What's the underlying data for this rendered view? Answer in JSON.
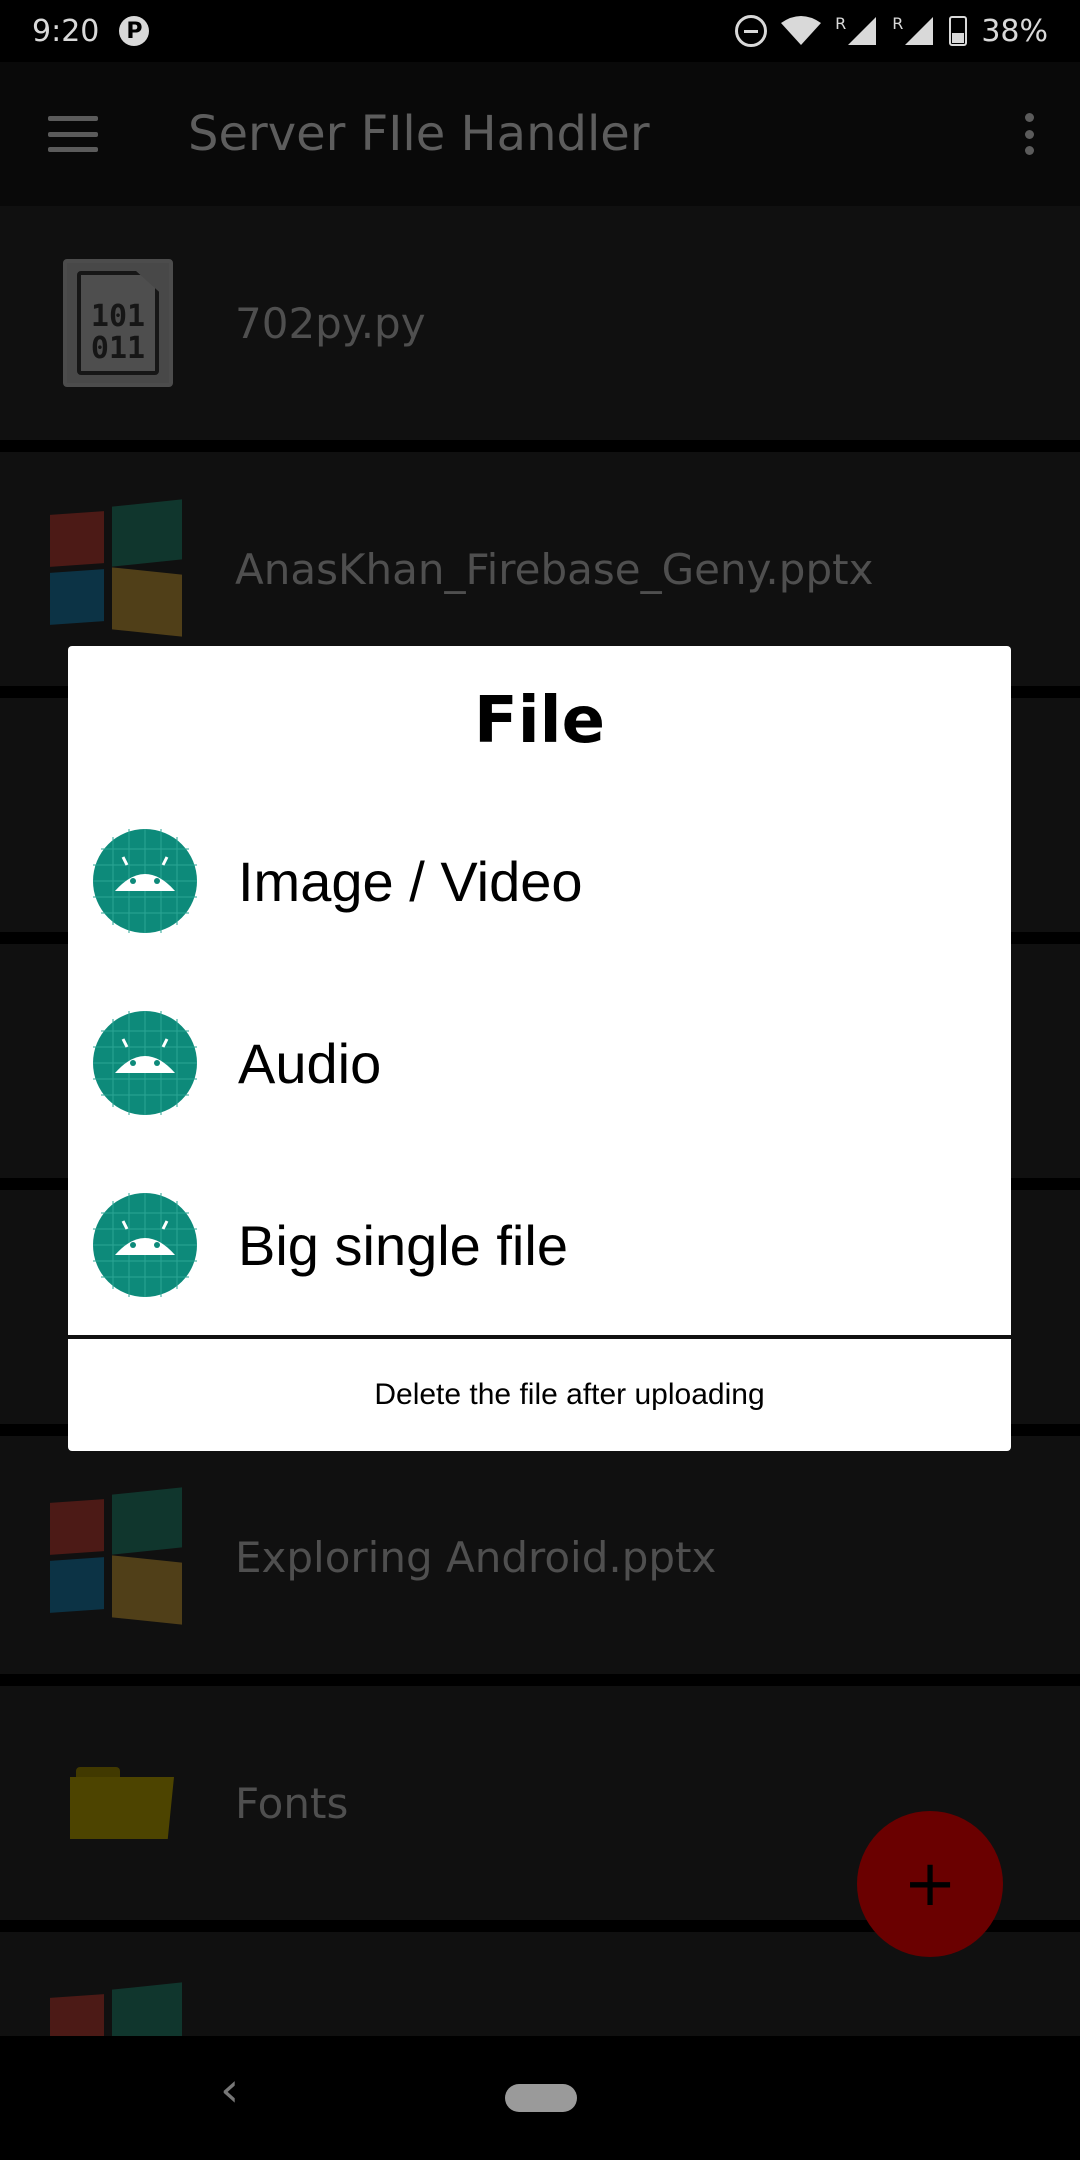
{
  "status_bar": {
    "time": "9:20",
    "notification_icon": "p-icon",
    "roaming_1": "R",
    "roaming_2": "R",
    "battery": "38%"
  },
  "app_bar": {
    "title": "Server FIle Handler",
    "menu_icon": "hamburger-menu-icon",
    "overflow_icon": "more-vert-icon"
  },
  "files": [
    {
      "name": "702py.py",
      "icon": "binary-file-icon"
    },
    {
      "name": "AnasKhan_Firebase_Geny.pptx",
      "icon": "windows-icon"
    },
    {
      "name": "Exploring Android.pptx",
      "icon": "windows-icon"
    },
    {
      "name": "Fonts",
      "icon": "folder-icon"
    }
  ],
  "dialog": {
    "title": "File",
    "options": [
      {
        "label": "Image / Video",
        "icon": "android-icon"
      },
      {
        "label": "Audio",
        "icon": "android-icon"
      },
      {
        "label": "Big single file",
        "icon": "android-icon"
      }
    ],
    "footer": "Delete the file after uploading"
  },
  "fab": {
    "label": "+"
  },
  "nav": {
    "back": "‹"
  },
  "colors": {
    "accent_fab": "#6a0000",
    "android_badge": "#0d8a7a",
    "list_row": "#131313"
  }
}
